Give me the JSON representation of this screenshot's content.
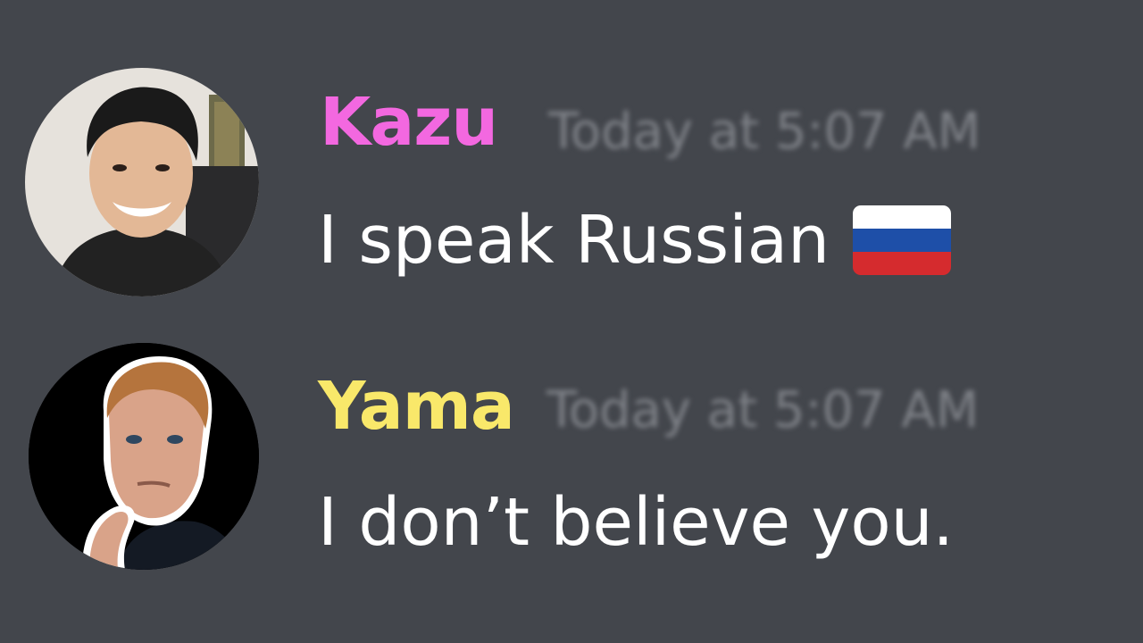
{
  "messages": [
    {
      "username": "Kazu",
      "username_color": "#f368e0",
      "timestamp": "Today at 5:07 AM",
      "text": "I speak Russian",
      "emoji": "flag-russia-icon",
      "avatar": "avatar-kazu"
    },
    {
      "username": "Yama",
      "username_color": "#f9e86a",
      "timestamp": "Today at 5:07 AM",
      "text": "I don’t believe you.",
      "avatar": "avatar-yama"
    }
  ],
  "colors": {
    "background": "#43464c",
    "timestamp": "#7e8187",
    "message_text": "#ffffff",
    "flag_white": "#ffffff",
    "flag_blue": "#1e4fa8",
    "flag_red": "#d52b2e"
  }
}
